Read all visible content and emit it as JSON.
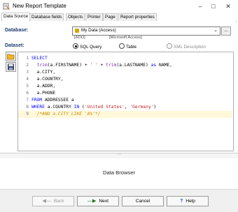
{
  "window": {
    "title": "New Report Template"
  },
  "tabs": [
    "Data Source",
    "Database fields",
    "Objects",
    "Printer",
    "Page",
    "Report properties"
  ],
  "database": {
    "label": "Database:",
    "selected": "My Data (Access)",
    "sub_left": "[ADO]",
    "sub_right": "[Microsoft Access]",
    "more_button": "..."
  },
  "dataset": {
    "label": "Dataset:",
    "options": [
      "SQL Query",
      "Table",
      "XML Description"
    ],
    "selected": "SQL Query"
  },
  "editor": {
    "lines": [
      {
        "num": "1",
        "segments": [
          {
            "t": "SELECT",
            "c": "kw"
          }
        ]
      },
      {
        "num": "2",
        "segments": [
          {
            "t": "  trim",
            "c": "fn"
          },
          {
            "t": "(a.FIRSTNAME) + ",
            "c": ""
          },
          {
            "t": "' '",
            "c": "str"
          },
          {
            "t": " + ",
            "c": ""
          },
          {
            "t": "trim",
            "c": "fn"
          },
          {
            "t": "(a.LASTNAME) ",
            "c": ""
          },
          {
            "t": "as",
            "c": "kw"
          },
          {
            "t": " NAME,",
            "c": ""
          }
        ]
      },
      {
        "num": "3",
        "segments": [
          {
            "t": "  a.CITY,",
            "c": ""
          }
        ]
      },
      {
        "num": "4",
        "segments": [
          {
            "t": "  a.COUNTRY,",
            "c": ""
          }
        ]
      },
      {
        "num": "5",
        "segments": [
          {
            "t": "  a.ADDR,",
            "c": ""
          }
        ]
      },
      {
        "num": "6",
        "segments": [
          {
            "t": "  a.PHONE",
            "c": ""
          }
        ]
      },
      {
        "num": "7",
        "segments": [
          {
            "t": "FROM",
            "c": "kw"
          },
          {
            "t": " ADDRESSEE a",
            "c": ""
          }
        ]
      },
      {
        "num": "8",
        "segments": [
          {
            "t": "WHERE",
            "c": "kw"
          },
          {
            "t": " a.COUNTRY ",
            "c": ""
          },
          {
            "t": "IN",
            "c": "kw"
          },
          {
            "t": " (",
            "c": ""
          },
          {
            "t": "'United States'",
            "c": "str"
          },
          {
            "t": ", ",
            "c": ""
          },
          {
            "t": "'Germany'",
            "c": "str"
          },
          {
            "t": ")",
            "c": ""
          }
        ]
      },
      {
        "num": "9",
        "segments": [
          {
            "t": "  /*AND a.CITY LIKE 'A%'*/",
            "c": "cmt"
          }
        ]
      }
    ]
  },
  "browser": {
    "label": "Data Browser"
  },
  "buttons": {
    "back": "Back",
    "next": "Next",
    "cancel": "Cancel",
    "help": "Help"
  }
}
